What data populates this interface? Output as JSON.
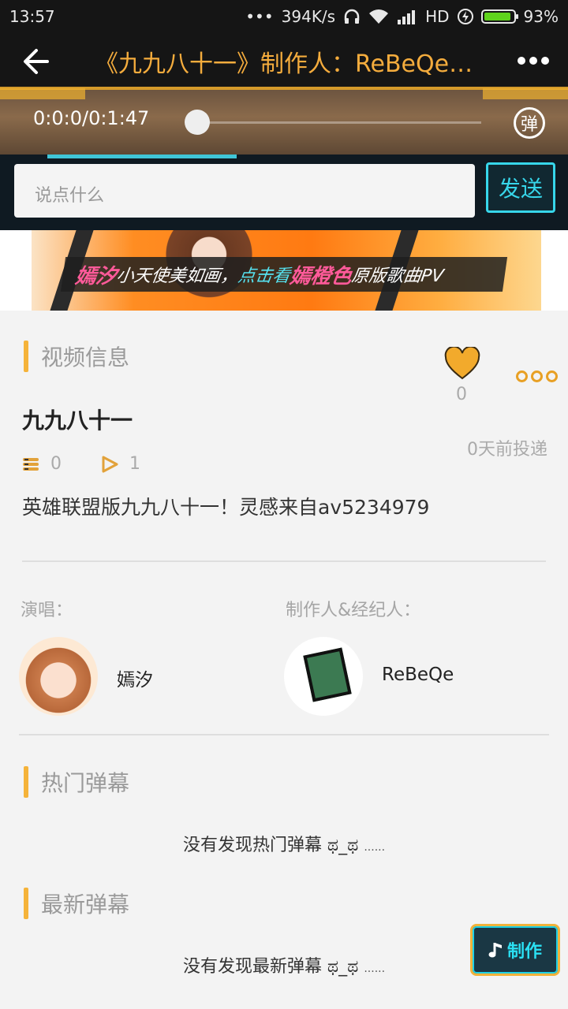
{
  "status_bar": {
    "time": "13:57",
    "dots": "•••",
    "speed": "394K/s",
    "network": "HD",
    "battery": "93%",
    "battery_level": 0.93
  },
  "header": {
    "title": "《九九八十一》制作人：ReBeQe ..."
  },
  "player": {
    "time": "0:0:0/0:1:47",
    "progress": 0,
    "danmaku_toggle": "弹"
  },
  "comment": {
    "placeholder": "说点什么",
    "send_label": "发送"
  },
  "banner": {
    "name1": "嫣汐",
    "text1": "小天使美如画，",
    "text2": "点击看",
    "name2": "嫣橙色",
    "text3": "原版歌曲PV"
  },
  "video_info": {
    "section_title": "视频信息",
    "like_count": "0",
    "title": "九九八十一",
    "post_time": "0天前投递",
    "danmaku_count": "0",
    "play_count": "1",
    "description": "英雄联盟版九九八十一！灵感来自av5234979"
  },
  "credits": {
    "singer_label": "演唱：",
    "singer_name": "嫣汐",
    "producer_label": "制作人&经纪人：",
    "producer_name": "ReBeQe"
  },
  "hot_danmaku": {
    "section_title": "热门弹幕",
    "empty_text": "没有发现热门弹幕 ಥ_ಥ",
    "ellipsis": "......"
  },
  "latest_danmaku": {
    "section_title": "最新弹幕",
    "empty_text": "没有发现最新弹幕 ಥ_ಥ",
    "ellipsis": "......"
  },
  "fab": {
    "label": "制作",
    "icon": "music-note-icon"
  },
  "colors": {
    "accent": "#f5b33a",
    "title": "#f4ac3d",
    "cyan": "#37d6ea"
  }
}
